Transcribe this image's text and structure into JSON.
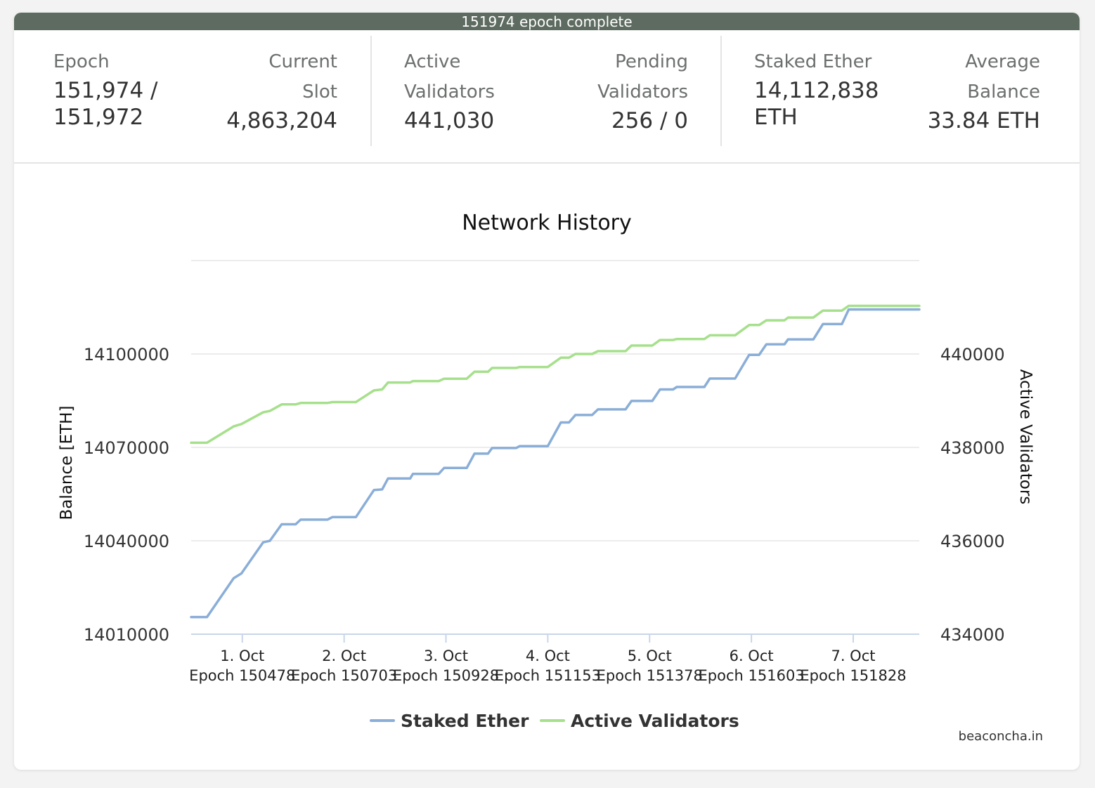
{
  "banner": {
    "text": "151974 epoch complete",
    "color": "#5d6b60"
  },
  "stats": {
    "epoch": {
      "label": "Epoch",
      "value_line1": "151,974 /",
      "value_line2": "151,972"
    },
    "current_slot": {
      "label_line1": "Current",
      "label_line2": "Slot",
      "value": "4,863,204"
    },
    "active_validators": {
      "label_line1": "Active",
      "label_line2": "Validators",
      "value": "441,030"
    },
    "pending_validators": {
      "label_line1": "Pending",
      "label_line2": "Validators",
      "value": "256 / 0"
    },
    "staked_ether": {
      "label": "Staked Ether",
      "value_line1": "14,112,838",
      "value_line2": "ETH"
    },
    "average_balance": {
      "label_line1": "Average",
      "label_line2": "Balance",
      "value": "33.84 ETH"
    }
  },
  "watermark": "beaconcha.in",
  "chart_data": {
    "type": "line",
    "title": "Network History",
    "y_left": {
      "label": "Balance [ETH]",
      "range": [
        14010000,
        14130000
      ],
      "ticks": [
        "14010000",
        "14040000",
        "14070000",
        "14100000"
      ]
    },
    "y_right": {
      "label": "Active Validators",
      "range": [
        434000,
        442000
      ],
      "ticks": [
        "434000",
        "436000",
        "438000",
        "440000"
      ]
    },
    "x": {
      "range": [
        150365,
        151974
      ]
    },
    "x_ticks": [
      {
        "x": 150478,
        "line1": "1. Oct",
        "line2": "Epoch 150478"
      },
      {
        "x": 150703,
        "line1": "2. Oct",
        "line2": "Epoch 150703"
      },
      {
        "x": 150928,
        "line1": "3. Oct",
        "line2": "Epoch 150928"
      },
      {
        "x": 151153,
        "line1": "4. Oct",
        "line2": "Epoch 151153"
      },
      {
        "x": 151378,
        "line1": "5. Oct",
        "line2": "Epoch 151378"
      },
      {
        "x": 151603,
        "line1": "6. Oct",
        "line2": "Epoch 151603"
      },
      {
        "x": 151828,
        "line1": "7. Oct",
        "line2": "Epoch 151828"
      }
    ],
    "grid": true,
    "legend_position": "bottom",
    "series": [
      {
        "name": "Staked Ether",
        "axis": "left",
        "color": "#8aaed8",
        "points": [
          [
            150365,
            14015500
          ],
          [
            150400,
            14015500
          ],
          [
            150459,
            14028000
          ],
          [
            150476,
            14029500
          ],
          [
            150524,
            14039500
          ],
          [
            150539,
            14040000
          ],
          [
            150565,
            14045300
          ],
          [
            150596,
            14045300
          ],
          [
            150607,
            14046800
          ],
          [
            150666,
            14046800
          ],
          [
            150677,
            14047600
          ],
          [
            150729,
            14047600
          ],
          [
            150769,
            14056300
          ],
          [
            150787,
            14056500
          ],
          [
            150800,
            14060000
          ],
          [
            150849,
            14060000
          ],
          [
            150855,
            14061500
          ],
          [
            150912,
            14061500
          ],
          [
            150924,
            14063400
          ],
          [
            150974,
            14063400
          ],
          [
            150991,
            14068000
          ],
          [
            151021,
            14068000
          ],
          [
            151030,
            14069800
          ],
          [
            151083,
            14069800
          ],
          [
            151091,
            14070400
          ],
          [
            151153,
            14070400
          ],
          [
            151182,
            14078000
          ],
          [
            151200,
            14078000
          ],
          [
            151214,
            14080400
          ],
          [
            151251,
            14080400
          ],
          [
            151264,
            14082200
          ],
          [
            151325,
            14082200
          ],
          [
            151338,
            14084900
          ],
          [
            151384,
            14084900
          ],
          [
            151401,
            14088600
          ],
          [
            151430,
            14088600
          ],
          [
            151438,
            14089400
          ],
          [
            151499,
            14089400
          ],
          [
            151511,
            14092100
          ],
          [
            151567,
            14092100
          ],
          [
            151598,
            14099700
          ],
          [
            151620,
            14099700
          ],
          [
            151636,
            14103100
          ],
          [
            151676,
            14103100
          ],
          [
            151684,
            14104700
          ],
          [
            151740,
            14104700
          ],
          [
            151761,
            14109600
          ],
          [
            151803,
            14109600
          ],
          [
            151818,
            14114300
          ],
          [
            151825,
            14114300
          ],
          [
            151944,
            14114300
          ],
          [
            151974,
            14114300
          ]
        ]
      },
      {
        "name": "Active Validators",
        "axis": "right",
        "color": "#a6e08c",
        "points": [
          [
            150365,
            438100
          ],
          [
            150400,
            438100
          ],
          [
            150459,
            438450
          ],
          [
            150476,
            438500
          ],
          [
            150524,
            438750
          ],
          [
            150539,
            438780
          ],
          [
            150565,
            438920
          ],
          [
            150596,
            438920
          ],
          [
            150607,
            438950
          ],
          [
            150666,
            438950
          ],
          [
            150677,
            438970
          ],
          [
            150729,
            438970
          ],
          [
            150769,
            439220
          ],
          [
            150787,
            439240
          ],
          [
            150800,
            439390
          ],
          [
            150849,
            439390
          ],
          [
            150855,
            439420
          ],
          [
            150912,
            439420
          ],
          [
            150924,
            439470
          ],
          [
            150974,
            439470
          ],
          [
            150991,
            439620
          ],
          [
            151021,
            439620
          ],
          [
            151030,
            439700
          ],
          [
            151083,
            439700
          ],
          [
            151091,
            439720
          ],
          [
            151153,
            439720
          ],
          [
            151182,
            439920
          ],
          [
            151200,
            439920
          ],
          [
            151214,
            440000
          ],
          [
            151251,
            440000
          ],
          [
            151264,
            440060
          ],
          [
            151325,
            440060
          ],
          [
            151338,
            440180
          ],
          [
            151384,
            440180
          ],
          [
            151401,
            440300
          ],
          [
            151430,
            440300
          ],
          [
            151438,
            440320
          ],
          [
            151499,
            440320
          ],
          [
            151511,
            440400
          ],
          [
            151567,
            440400
          ],
          [
            151598,
            440620
          ],
          [
            151620,
            440620
          ],
          [
            151636,
            440720
          ],
          [
            151676,
            440720
          ],
          [
            151684,
            440780
          ],
          [
            151740,
            440780
          ],
          [
            151761,
            440930
          ],
          [
            151803,
            440930
          ],
          [
            151818,
            441030
          ],
          [
            151825,
            441030
          ],
          [
            151944,
            441030
          ],
          [
            151974,
            441030
          ]
        ]
      }
    ]
  }
}
